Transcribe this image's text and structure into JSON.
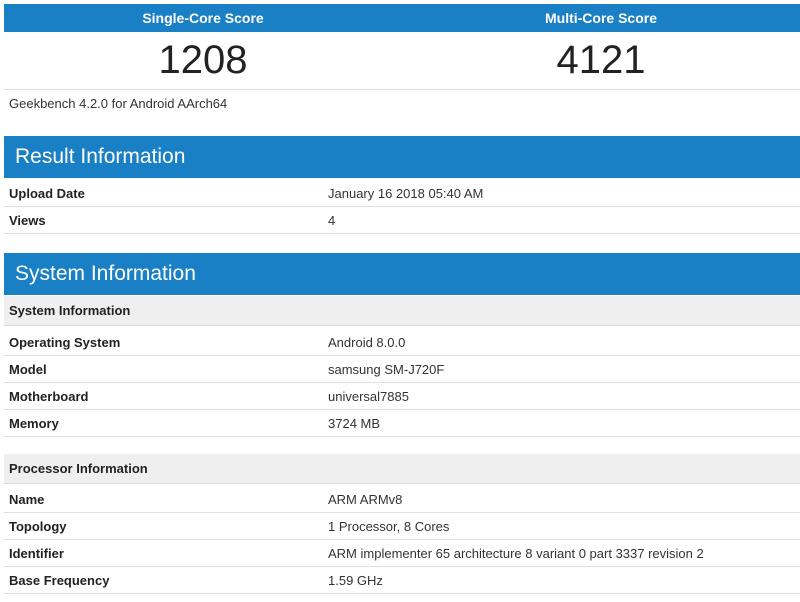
{
  "scores": {
    "single_label": "Single-Core Score",
    "multi_label": "Multi-Core Score",
    "single_value": "1208",
    "multi_value": "4121"
  },
  "version_text": "Geekbench 4.2.0 for Android AArch64",
  "result": {
    "title": "Result Information",
    "rows": [
      {
        "key": "Upload Date",
        "value": "January 16 2018 05:40 AM"
      },
      {
        "key": "Views",
        "value": "4"
      }
    ]
  },
  "system": {
    "title": "System Information",
    "sysinfo": {
      "subtitle": "System Information",
      "rows": [
        {
          "key": "Operating System",
          "value": "Android 8.0.0"
        },
        {
          "key": "Model",
          "value": "samsung SM-J720F"
        },
        {
          "key": "Motherboard",
          "value": "universal7885"
        },
        {
          "key": "Memory",
          "value": "3724 MB"
        }
      ]
    },
    "processor": {
      "subtitle": "Processor Information",
      "rows": [
        {
          "key": "Name",
          "value": "ARM ARMv8"
        },
        {
          "key": "Topology",
          "value": "1 Processor, 8 Cores"
        },
        {
          "key": "Identifier",
          "value": "ARM implementer 65 architecture 8 variant 0 part 3337 revision 2"
        },
        {
          "key": "Base Frequency",
          "value": "1.59 GHz"
        }
      ]
    }
  },
  "colors": {
    "accent": "#1a80c5",
    "subheader_bg": "#efefef"
  }
}
